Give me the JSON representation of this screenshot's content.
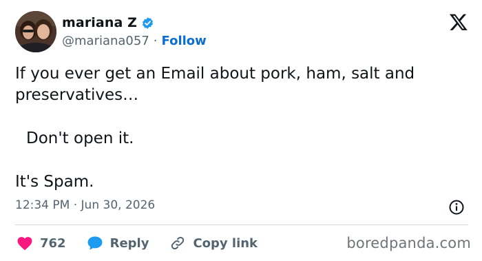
{
  "user": {
    "display_name": "mariana Z",
    "handle": "@mariana057",
    "separator": "·",
    "follow_label": "Follow"
  },
  "tweet": {
    "line1": "If you ever get an Email about pork, ham, salt and preservatives…",
    "line2": "Don't open it.",
    "line3": "It's Spam."
  },
  "meta": {
    "time": "12:34 PM",
    "separator": "·",
    "date": "Jun 30, 2026"
  },
  "actions": {
    "like_count": "762",
    "reply_label": "Reply",
    "copy_link_label": "Copy link"
  },
  "watermark": "boredpanda.com",
  "colors": {
    "accent": "#0a6ed1",
    "like": "#f91880",
    "reply": "#1d9bf0",
    "muted": "#536471",
    "divider": "#cfd9de"
  },
  "icons": [
    "verified-badge-icon",
    "x-logo-icon",
    "info-icon",
    "heart-icon",
    "reply-bubble-icon",
    "link-icon"
  ]
}
